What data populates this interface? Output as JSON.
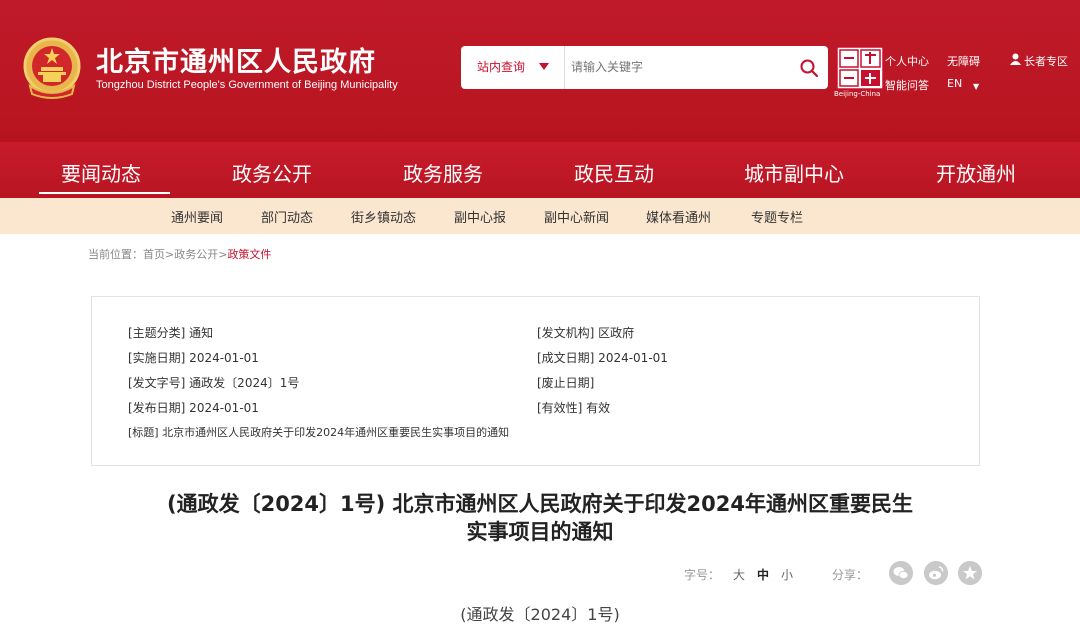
{
  "header": {
    "site_title": "北京市通州区人民政府",
    "site_subtitle": "Tongzhou District People's Government of Beijing Municipality",
    "search": {
      "scope_label": "站内查询",
      "placeholder": "请输入关键字"
    },
    "top_links": {
      "personal_center": "个人中心",
      "accessibility": "无障碍",
      "elder_zone": "长者专区",
      "smart_qa": "智能问答",
      "english": "EN"
    },
    "capital_logo_caption": "Beijing-China"
  },
  "nav": {
    "items": [
      "要闻动态",
      "政务公开",
      "政务服务",
      "政民互动",
      "城市副中心",
      "开放通州"
    ],
    "active_index": 0
  },
  "subnav": {
    "items": [
      "通州要闻",
      "部门动态",
      "街乡镇动态",
      "副中心报",
      "副中心新闻",
      "媒体看通州",
      "专题专栏"
    ]
  },
  "breadcrumb": {
    "prefix": "当前位置：",
    "items": [
      "首页",
      "政务公开",
      "政策文件"
    ],
    "separator": ">"
  },
  "meta": {
    "topic": "[主题分类] 通知",
    "issuer": "[发文机构] 区政府",
    "effective_date": "[实施日期] 2024-01-01",
    "written_date": "[成文日期] 2024-01-01",
    "doc_number": "[发文字号] 通政发〔2024〕1号",
    "expiry_date": "[废止日期]",
    "publish_date": "[发布日期] 2024-01-01",
    "validity": "[有效性] 有效",
    "subject": "[标题] 北京市通州区人民政府关于印发2024年通州区重要民生实事项目的通知"
  },
  "article": {
    "title_line1": "(通政发〔2024〕1号) 北京市通州区人民政府关于印发2024年通州区重要民生",
    "title_line2": "实事项目的通知",
    "font_size_label": "字号：",
    "font_sizes": [
      "大",
      "中",
      "小"
    ],
    "share_label": "分享：",
    "doc_number": "(通政发〔2024〕1号)"
  },
  "colors": {
    "brand_red": "#c8102e",
    "subnav_bg": "#fbe7cf",
    "active_size": "#222"
  },
  "icons": [
    "national-emblem-icon",
    "chevron-down-icon",
    "search-icon",
    "user-icon",
    "wechat-icon",
    "weibo-icon",
    "favorite-icon"
  ]
}
